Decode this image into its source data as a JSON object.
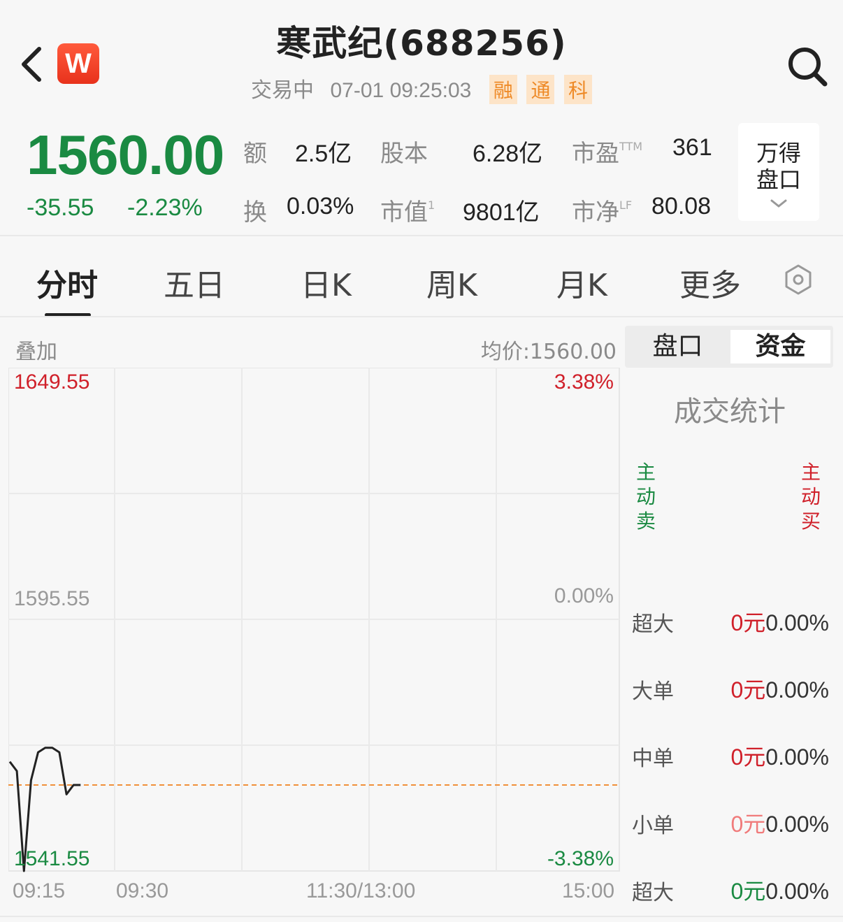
{
  "header": {
    "logo_text": "W",
    "title": "寒武纪(688256)",
    "status": "交易中",
    "datetime": "07-01 09:25:03",
    "badges": [
      "融",
      "通",
      "科"
    ]
  },
  "quote": {
    "price": "1560.00",
    "change": "-35.55",
    "change_pct": "-2.23%",
    "stats": [
      {
        "label": "额",
        "value": "2.5亿"
      },
      {
        "label": "股本",
        "value": "6.28亿"
      },
      {
        "label": "市盈",
        "sup": "TTM",
        "value": "361"
      },
      {
        "label": "换",
        "value": "0.03%"
      },
      {
        "label": "市值",
        "sup": "1",
        "value": "9801亿"
      },
      {
        "label": "市净",
        "sup": "LF",
        "value": "80.08"
      }
    ],
    "wind_button": [
      "万得",
      "盘口"
    ]
  },
  "tabs": [
    "分时",
    "五日",
    "日K",
    "周K",
    "月K",
    "更多"
  ],
  "chart": {
    "overlay_label": "叠加",
    "avg_price_label": "均价:1560.00",
    "y_high": "1649.55",
    "y_mid": "1595.55",
    "y_low": "1541.55",
    "pct_high": "3.38%",
    "pct_mid": "0.00%",
    "pct_low": "-3.38%",
    "time_labels": [
      "09:15",
      "09:30",
      "11:30/13:00",
      "15:00"
    ],
    "colors": {
      "up": "#d0202a",
      "down": "#1a8a42",
      "avg_line": "#f0903a"
    }
  },
  "chart_data": {
    "type": "line",
    "title": "",
    "xlabel": "",
    "ylabel": "",
    "ylim": [
      1541.55,
      1649.55
    ],
    "x": [
      "09:15",
      "09:16",
      "09:17",
      "09:18",
      "09:19",
      "09:20",
      "09:21",
      "09:22",
      "09:23",
      "09:24",
      "09:25"
    ],
    "series": [
      {
        "values": [
          1565,
          1563,
          1541.55,
          1561,
          1567,
          1568,
          1568,
          1567,
          1558,
          1560,
          1560
        ]
      }
    ],
    "reference": 1560.0
  },
  "panel": {
    "tabs": [
      "盘口",
      "资金"
    ],
    "active_tab": 1,
    "title": "成交统计",
    "sell_label": [
      "主",
      "动",
      "卖"
    ],
    "buy_label": [
      "主",
      "动",
      "买"
    ],
    "rows": [
      {
        "label": "超大",
        "amount": "0元",
        "pct": "0.00%",
        "color": "#d0202a"
      },
      {
        "label": "大单",
        "amount": "0元",
        "pct": "0.00%",
        "color": "#d0202a"
      },
      {
        "label": "中单",
        "amount": "0元",
        "pct": "0.00%",
        "color": "#d0202a"
      },
      {
        "label": "小单",
        "amount": "0元",
        "pct": "0.00%",
        "color": "#f07b7b"
      },
      {
        "label": "超大",
        "amount": "0元",
        "pct": "0.00%",
        "color": "#1a8a42"
      }
    ]
  }
}
